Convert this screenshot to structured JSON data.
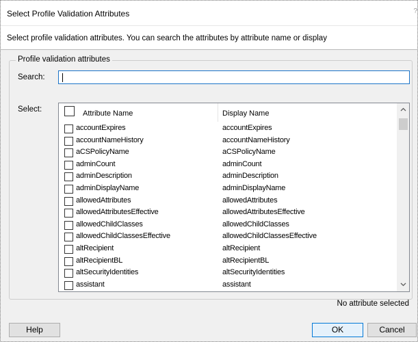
{
  "window": {
    "title": "Select Profile Validation Attributes",
    "edge_glyph": "?"
  },
  "description": "Select profile validation attributes. You can search the attributes by attribute name or display",
  "group": {
    "label": "Profile validation attributes"
  },
  "search": {
    "label": "Search:",
    "value": ""
  },
  "select": {
    "label": "Select:",
    "columns": {
      "attribute_name": "Attribute Name",
      "display_name": "Display Name"
    },
    "rows": [
      {
        "name": "accountExpires",
        "display": "accountExpires"
      },
      {
        "name": "accountNameHistory",
        "display": "accountNameHistory"
      },
      {
        "name": "aCSPolicyName",
        "display": "aCSPolicyName"
      },
      {
        "name": "adminCount",
        "display": "adminCount"
      },
      {
        "name": "adminDescription",
        "display": "adminDescription"
      },
      {
        "name": "adminDisplayName",
        "display": "adminDisplayName"
      },
      {
        "name": "allowedAttributes",
        "display": "allowedAttributes"
      },
      {
        "name": "allowedAttributesEffective",
        "display": "allowedAttributesEffective"
      },
      {
        "name": "allowedChildClasses",
        "display": "allowedChildClasses"
      },
      {
        "name": "allowedChildClassesEffective",
        "display": "allowedChildClassesEffective"
      },
      {
        "name": "altRecipient",
        "display": "altRecipient"
      },
      {
        "name": "altRecipientBL",
        "display": "altRecipientBL"
      },
      {
        "name": "altSecurityIdentities",
        "display": "altSecurityIdentities"
      },
      {
        "name": "assistant",
        "display": "assistant"
      }
    ],
    "scroll_up_icon": "chevron-up-icon",
    "scroll_down_icon": "chevron-down-icon"
  },
  "status": "No attribute selected",
  "buttons": {
    "help": "Help",
    "ok": "OK",
    "cancel": "Cancel"
  },
  "colors": {
    "focus_border": "#1a73c8",
    "ok_border": "#0078d7"
  }
}
